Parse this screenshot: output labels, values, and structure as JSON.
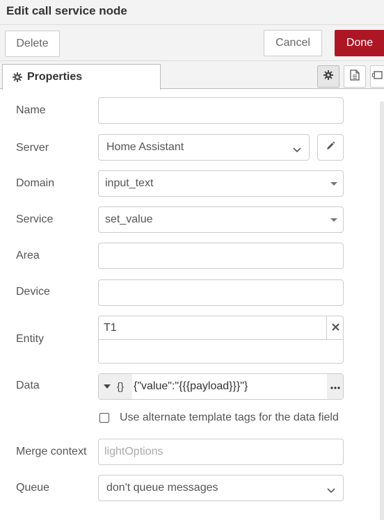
{
  "dialog": {
    "title": "Edit call service node"
  },
  "toolbar": {
    "delete_label": "Delete",
    "cancel_label": "Cancel",
    "done_label": "Done"
  },
  "tabs": {
    "properties_label": "Properties"
  },
  "form": {
    "name": {
      "label": "Name",
      "value": ""
    },
    "server": {
      "label": "Server",
      "value": "Home Assistant"
    },
    "domain": {
      "label": "Domain",
      "value": "input_text"
    },
    "service": {
      "label": "Service",
      "value": "set_value"
    },
    "area": {
      "label": "Area",
      "value": ""
    },
    "device": {
      "label": "Device",
      "value": ""
    },
    "entity": {
      "label": "Entity",
      "token": "T1"
    },
    "data": {
      "label": "Data",
      "type_label": "{}",
      "value": "{\"value\":\"{{{payload}}}\"}"
    },
    "alt_tags": {
      "label": "Use alternate template tags for the data field",
      "checked": false
    },
    "merge_context": {
      "label": "Merge context",
      "placeholder": "lightOptions"
    },
    "queue": {
      "label": "Queue",
      "value": "don't queue messages"
    }
  },
  "colors": {
    "done": "#ad1625",
    "panel": "#f3f3f3",
    "border": "#cccccc"
  }
}
